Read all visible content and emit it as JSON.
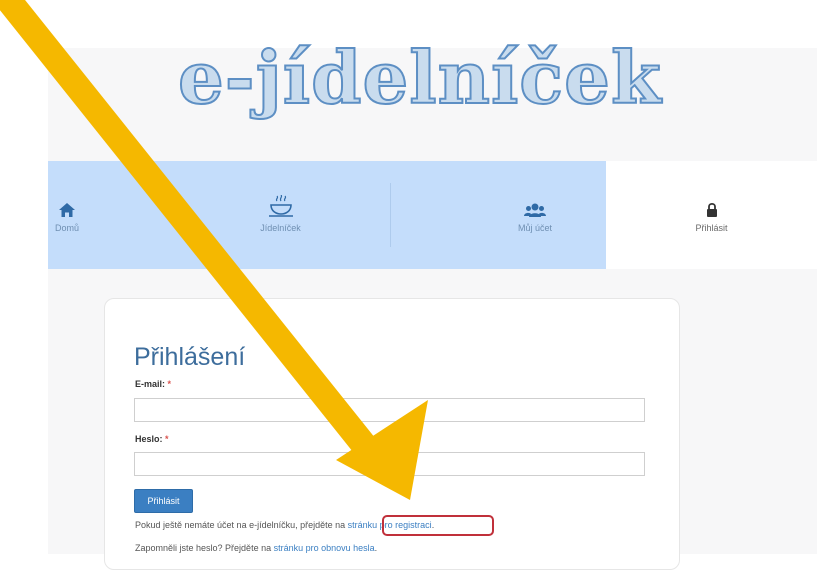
{
  "site": {
    "logo_text": "e-jídelníček"
  },
  "nav": {
    "items": [
      {
        "label": "Domů",
        "icon": "home-icon"
      },
      {
        "label": "Jídelníček",
        "icon": "food-bowl-icon"
      },
      {
        "label": "Můj účet",
        "icon": "users-icon"
      },
      {
        "label": "Přihlásit",
        "icon": "lock-icon",
        "active": true
      }
    ]
  },
  "login": {
    "title": "Přihlášení",
    "email_label": "E-mail:",
    "password_label": "Heslo:",
    "required_mark": "*",
    "email_value": "",
    "password_value": "",
    "submit_label": "Přihlásit",
    "register_text": "Pokud ještě nemáte účet na e-jídelníčku, přejděte na ",
    "register_link": "stránku pro registraci",
    "register_end": ".",
    "forgot_text": "Zapomněli jste heslo? Přejděte na ",
    "forgot_link": "stránku pro obnovu hesla",
    "forgot_end": "."
  },
  "annotation": {
    "arrow_color": "#f5b800",
    "highlight_color": "#c0303a"
  }
}
